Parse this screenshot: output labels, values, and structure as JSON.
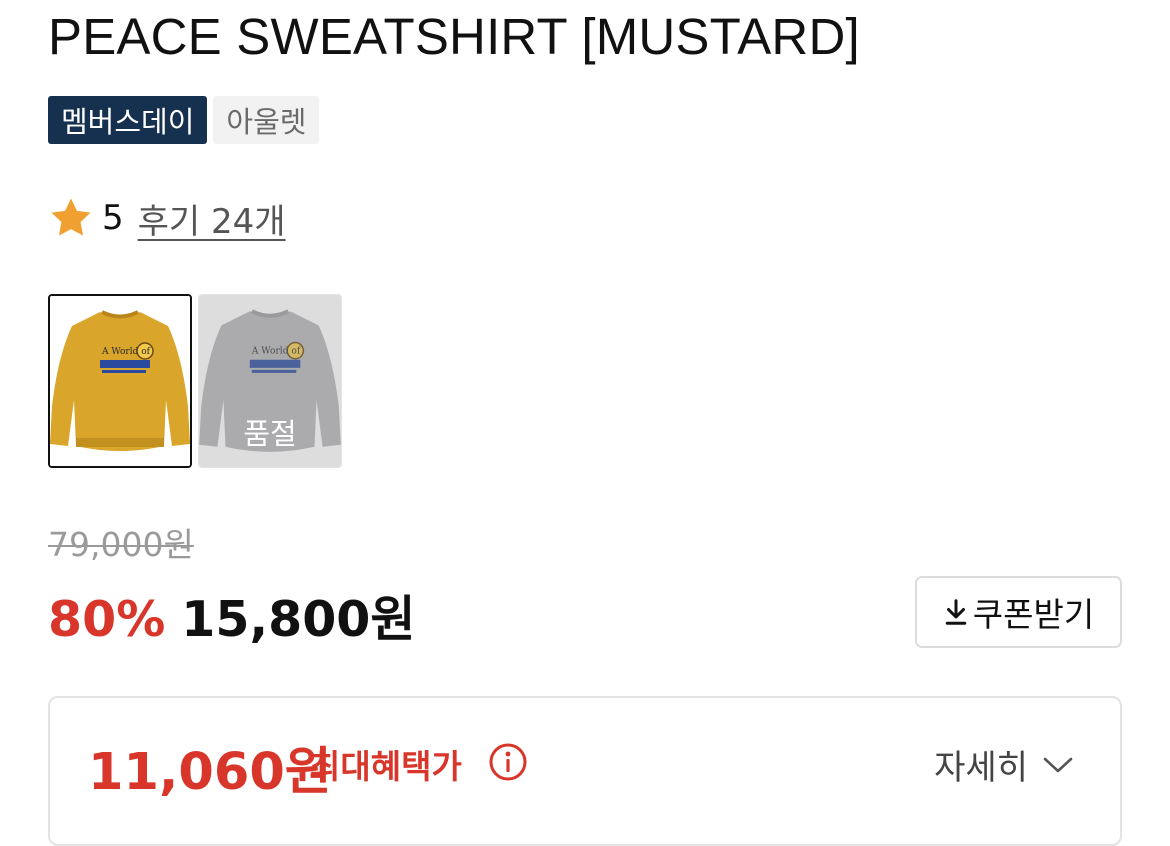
{
  "product": {
    "title": "PEACE SWEATSHIRT [MUSTARD]",
    "badges": [
      "멤버스데이",
      "아울렛"
    ]
  },
  "rating": {
    "score": "5",
    "reviews_label": "후기 24개",
    "star_icon": "star-icon",
    "star_color": "#f0a030"
  },
  "variants": [
    {
      "color_name": "mustard",
      "swatch": "#d9a52a",
      "selected": true,
      "print_text": "A World of"
    },
    {
      "color_name": "gray",
      "swatch": "#b5b5ba",
      "selected": false,
      "soldout_label": "품절",
      "print_text": "A World of"
    }
  ],
  "pricing": {
    "original_price": "79,000원",
    "discount_rate": "80%",
    "sale_price": "15,800원",
    "coupon_button": "쿠폰받기",
    "coupon_icon": "download-icon"
  },
  "benefit": {
    "max_price": "11,060원",
    "label": "최대혜택가",
    "info_icon": "info-icon",
    "detail_label": "자세히",
    "detail_icon": "chevron-down-icon"
  },
  "colors": {
    "accent_red": "#d8362b",
    "navy_badge": "#16304f",
    "muted_text": "#9a9a9a"
  }
}
